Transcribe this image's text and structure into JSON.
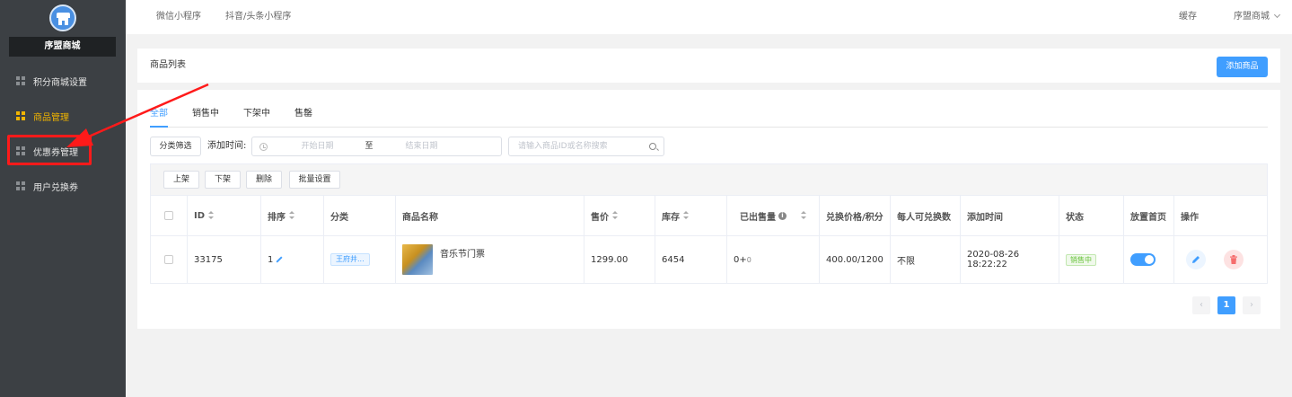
{
  "sidebar": {
    "brand": "序盟商城",
    "items": [
      {
        "label": "积分商城设置",
        "active": false
      },
      {
        "label": "商品管理",
        "active": true
      },
      {
        "label": "优惠券管理",
        "active": false
      },
      {
        "label": "用户兑换券",
        "active": false
      }
    ]
  },
  "topbar": {
    "tabs": [
      "微信小程序",
      "抖音/头条小程序"
    ],
    "cache": "缓存",
    "store": "序盟商城"
  },
  "page": {
    "title": "商品列表",
    "add_button": "添加商品"
  },
  "tabs": {
    "all": "全部",
    "on_sale": "销售中",
    "off_shelf": "下架中",
    "sold_out": "售罄"
  },
  "filters": {
    "category_button": "分类筛选",
    "add_time_label": "添加时间:",
    "start_placeholder": "开始日期",
    "range_sep": "至",
    "end_placeholder": "结束日期",
    "search_placeholder": "请输入商品ID或名称搜索"
  },
  "batch": {
    "up": "上架",
    "down": "下架",
    "delete": "删除",
    "batch_set": "批量设置"
  },
  "table": {
    "headers": {
      "id": "ID",
      "sort": "排序",
      "category": "分类",
      "name": "商品名称",
      "price": "售价",
      "stock": "库存",
      "sold": "已出售量",
      "exchange": "兑换价格/积分",
      "per_user": "每人可兑换数",
      "add_time": "添加时间",
      "status": "状态",
      "home": "放置首页",
      "ops": "操作"
    },
    "rows": [
      {
        "id": "33175",
        "sort": "1",
        "category": "王府井...",
        "name": "音乐节门票",
        "price": "1299.00",
        "stock": "6454",
        "sold_main": "0+",
        "sold_sub": "0",
        "exchange": "400.00/1200",
        "per_user": "不限",
        "add_time": "2020-08-26 18:22:22",
        "status": "销售中",
        "home_on": true
      }
    ]
  },
  "pagination": {
    "current": "1"
  },
  "colors": {
    "accent": "#409eff",
    "sidebar_bg": "#3c4044",
    "active_menu": "#f0b400",
    "annotation": "#ff1a1a"
  }
}
